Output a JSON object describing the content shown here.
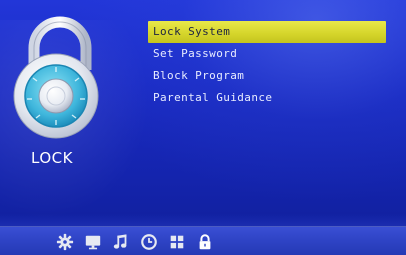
{
  "screen": {
    "title": "LOCK"
  },
  "menu": {
    "items": [
      {
        "label": "Lock System",
        "selected": true
      },
      {
        "label": "Set Password",
        "selected": false
      },
      {
        "label": "Block Program",
        "selected": false
      },
      {
        "label": "Parental Guidance",
        "selected": false
      }
    ]
  },
  "bottom_bar": {
    "icons": [
      {
        "name": "gear-icon"
      },
      {
        "name": "monitor-icon"
      },
      {
        "name": "music-note-icon"
      },
      {
        "name": "clock-icon"
      },
      {
        "name": "grid-icon"
      },
      {
        "name": "lock-icon",
        "active": true
      }
    ]
  },
  "colors": {
    "background": "#1a2bc4",
    "highlight": "#e0e03a",
    "menu_text": "#e8ecff",
    "bar": "#2f44c6"
  }
}
